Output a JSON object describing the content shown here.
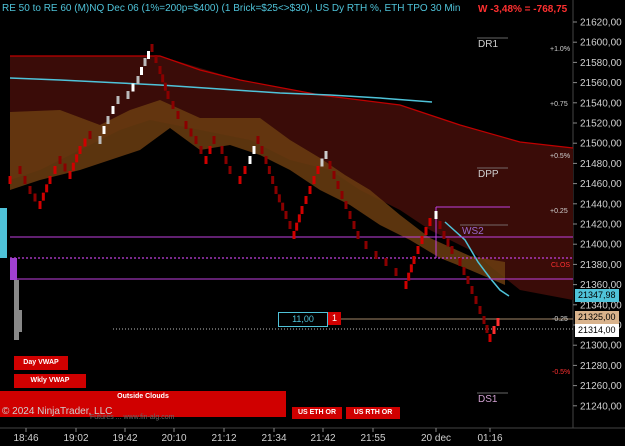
{
  "header": {
    "title": "RE 50 to RE 60 (M)NQ Dec 06 (1%=200p=$400) (1 Brick=$25<>$30), US Dy RTH %, ETH TPO 30 Min",
    "pnl": "W -3,48% = -768,75"
  },
  "price_axis": {
    "ticks": [
      "21620,00",
      "21600,00",
      "21580,00",
      "21560,00",
      "21540,00",
      "21520,00",
      "21500,00",
      "21480,00",
      "21460,00",
      "21440,00",
      "21420,00",
      "21400,00",
      "21380,00",
      "21360,00",
      "21340,00",
      "21320,00",
      "21300,00",
      "21280,00",
      "21260,00",
      "21240,00"
    ],
    "ylim": [
      21230,
      21630
    ],
    "tags": [
      {
        "text": "21347,98",
        "value": 21347.98,
        "bg": "#4fc3d9",
        "fg": "#000000"
      },
      {
        "text": "21325,00",
        "value": 21325,
        "bg": "#d9b38c",
        "fg": "#000000"
      },
      {
        "text": "21314,00",
        "value": 21314,
        "bg": "#ffffff",
        "fg": "#000000"
      }
    ]
  },
  "time_axis": {
    "labels": [
      "18:46",
      "19:02",
      "19:42",
      "20:10",
      "21:12",
      "21:34",
      "21:42",
      "21:55",
      "20 dec",
      "01:16"
    ]
  },
  "levels": [
    {
      "name": "DR1",
      "value": 21595
    },
    {
      "name": "DPP",
      "value": 21458
    },
    {
      "name": "WS2",
      "value": 21408
    },
    {
      "name": "DS1",
      "value": 21245
    },
    {
      "name": "CLOS",
      "value": 21375
    }
  ],
  "percent_marks": [
    {
      "text": "+1.0%",
      "value": 21595
    },
    {
      "text": "+0.75",
      "value": 21545
    },
    {
      "text": "+0.5%",
      "value": 21495
    },
    {
      "text": "+0.25",
      "value": 21440
    },
    {
      "text": "-0.25",
      "value": 21325
    },
    {
      "text": "-0.5%",
      "value": 21272
    }
  ],
  "order": {
    "price": "11,00",
    "qty": "1",
    "value": 21325
  },
  "labels": {
    "day_vwap": "Day VWAP",
    "wkly_vwap": "Wkly VWAP",
    "outside_clouds": "Outside Clouds",
    "us_eth_or": "US ETH OR",
    "us_rth_or": "US RTH OR"
  },
  "footer": {
    "copyright": "© 2024 NinjaTrader, LLC",
    "sub": "Futures ... www.fin-alg.com"
  },
  "colors": {
    "bull": "#d00000",
    "bear": "#8a0000",
    "cyan_line": "#4fc3d9",
    "cloud_brown": "#6b3d10",
    "cloud_red": "#3a0c08",
    "magenta": "#c040e0"
  },
  "chart_data": {
    "type": "line",
    "series": [
      {
        "values": [
          21470,
          21490,
          21500,
          21480,
          21500,
          21520,
          21510,
          21540,
          21550,
          21560,
          21580,
          21590,
          21570,
          21540,
          21520,
          21530,
          21510,
          21490,
          21500,
          21480,
          21460,
          21480,
          21500,
          21490,
          21470,
          21450,
          21430,
          21420,
          21440,
          21460,
          21470,
          21450,
          21430,
          21410,
          21400,
          21390,
          21380,
          21370,
          21360,
          21390,
          21420,
          21430,
          21400,
          21380,
          21360,
          21340,
          21320,
          21310,
          21320
        ]
      }
    ]
  }
}
